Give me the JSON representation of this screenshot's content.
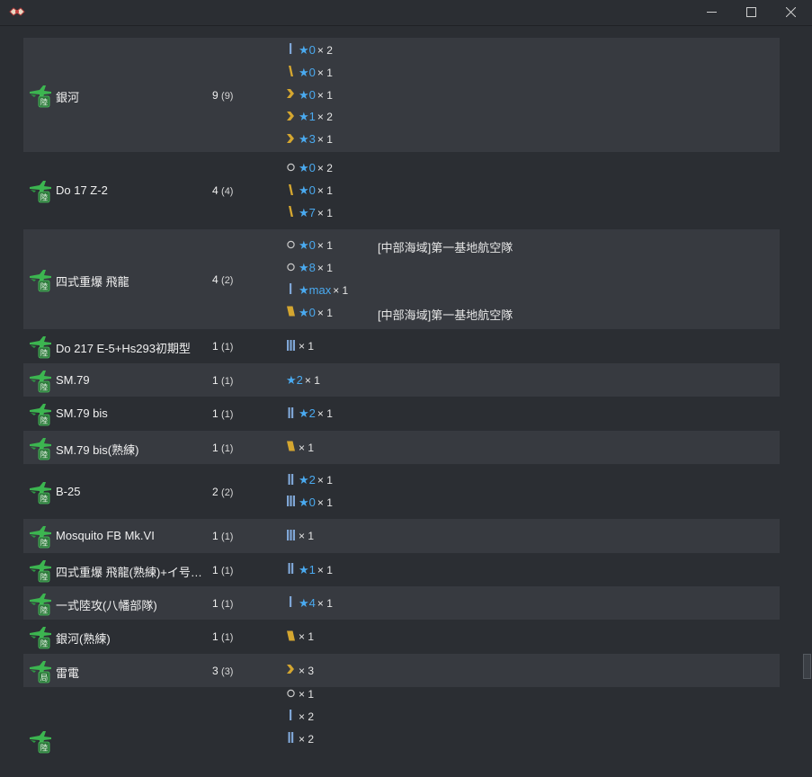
{
  "window": {
    "icon": "app-logo-icon",
    "buttons": {
      "minimize": "minimize-icon",
      "maximize": "maximize-icon",
      "close": "close-icon"
    }
  },
  "colors": {
    "background": "#2b2e33",
    "row_alt": "#373a40",
    "star": "#4aaaf0",
    "plane_green": "#3cb550",
    "badge_green": "#2e7a3c"
  },
  "rows": [
    {
      "name": "銀河",
      "badge": "陸",
      "count": "9",
      "count_paren": "(9)",
      "details": [
        {
          "icon": "bar-1",
          "star": "★0",
          "mult": "× 2"
        },
        {
          "icon": "slash-1",
          "star": "★0",
          "mult": "× 1"
        },
        {
          "icon": "chevron-gold",
          "star": "★0",
          "mult": "× 1"
        },
        {
          "icon": "chevron-gold",
          "star": "★1",
          "mult": "× 2"
        },
        {
          "icon": "chevron-gold",
          "star": "★3",
          "mult": "× 1"
        }
      ]
    },
    {
      "name": "Do 17 Z-2",
      "badge": "陸",
      "count": "4",
      "count_paren": "(4)",
      "details": [
        {
          "icon": "circle",
          "star": "★0",
          "mult": "× 2"
        },
        {
          "icon": "slash-1",
          "star": "★0",
          "mult": "× 1"
        },
        {
          "icon": "slash-1",
          "star": "★7",
          "mult": "× 1"
        }
      ]
    },
    {
      "name": "四式重爆 飛龍",
      "badge": "陸",
      "count": "4",
      "count_paren": "(2)",
      "details": [
        {
          "icon": "circle",
          "star": "★0",
          "mult": "× 1",
          "note": "[中部海域]第一基地航空隊"
        },
        {
          "icon": "circle",
          "star": "★8",
          "mult": "× 1"
        },
        {
          "icon": "bar-1",
          "star": "★max",
          "mult": "× 1"
        },
        {
          "icon": "gold-block",
          "star": "★0",
          "mult": "× 1",
          "note": "[中部海域]第一基地航空隊"
        }
      ]
    },
    {
      "name": "Do 217 E-5+Hs293初期型",
      "badge": "陸",
      "count": "1",
      "count_paren": "(1)",
      "details": [
        {
          "icon": "bar-3",
          "star": "",
          "mult": "× 1"
        }
      ]
    },
    {
      "name": "SM.79",
      "badge": "陸",
      "count": "1",
      "count_paren": "(1)",
      "details": [
        {
          "icon": "none",
          "star": "★2",
          "mult": "× 1"
        }
      ]
    },
    {
      "name": "SM.79 bis",
      "badge": "陸",
      "count": "1",
      "count_paren": "(1)",
      "details": [
        {
          "icon": "bar-2",
          "star": "★2",
          "mult": "× 1"
        }
      ]
    },
    {
      "name": "SM.79 bis(熟練)",
      "badge": "陸",
      "count": "1",
      "count_paren": "(1)",
      "details": [
        {
          "icon": "gold-block",
          "star": "",
          "mult": "× 1"
        }
      ]
    },
    {
      "name": "B-25",
      "badge": "陸",
      "count": "2",
      "count_paren": "(2)",
      "details": [
        {
          "icon": "bar-2",
          "star": "★2",
          "mult": "× 1"
        },
        {
          "icon": "bar-3",
          "star": "★0",
          "mult": "× 1"
        }
      ]
    },
    {
      "name": "Mosquito FB Mk.VI",
      "badge": "陸",
      "count": "1",
      "count_paren": "(1)",
      "details": [
        {
          "icon": "bar-3",
          "star": "",
          "mult": "× 1"
        }
      ]
    },
    {
      "name": "四式重爆 飛龍(熟練)+イ号…",
      "badge": "陸",
      "count": "1",
      "count_paren": "(1)",
      "details": [
        {
          "icon": "bar-2",
          "star": "★1",
          "mult": "× 1"
        }
      ]
    },
    {
      "name": "一式陸攻(八幡部隊)",
      "badge": "陸",
      "count": "1",
      "count_paren": "(1)",
      "details": [
        {
          "icon": "bar-1",
          "star": "★4",
          "mult": "× 1"
        }
      ]
    },
    {
      "name": "銀河(熟練)",
      "badge": "陸",
      "count": "1",
      "count_paren": "(1)",
      "details": [
        {
          "icon": "gold-block",
          "star": "",
          "mult": "× 1"
        }
      ]
    },
    {
      "name": "雷電",
      "badge": "局",
      "count": "3",
      "count_paren": "(3)",
      "details": [
        {
          "icon": "chevron-gold",
          "star": "",
          "mult": "× 3"
        }
      ]
    },
    {
      "name": "",
      "badge": "陸",
      "count": "",
      "count_paren": "",
      "details": [
        {
          "icon": "circle",
          "star": "",
          "mult": "× 1"
        },
        {
          "icon": "bar-1",
          "star": "",
          "mult": "× 2"
        },
        {
          "icon": "bar-2",
          "star": "",
          "mult": "× 2"
        }
      ]
    }
  ]
}
